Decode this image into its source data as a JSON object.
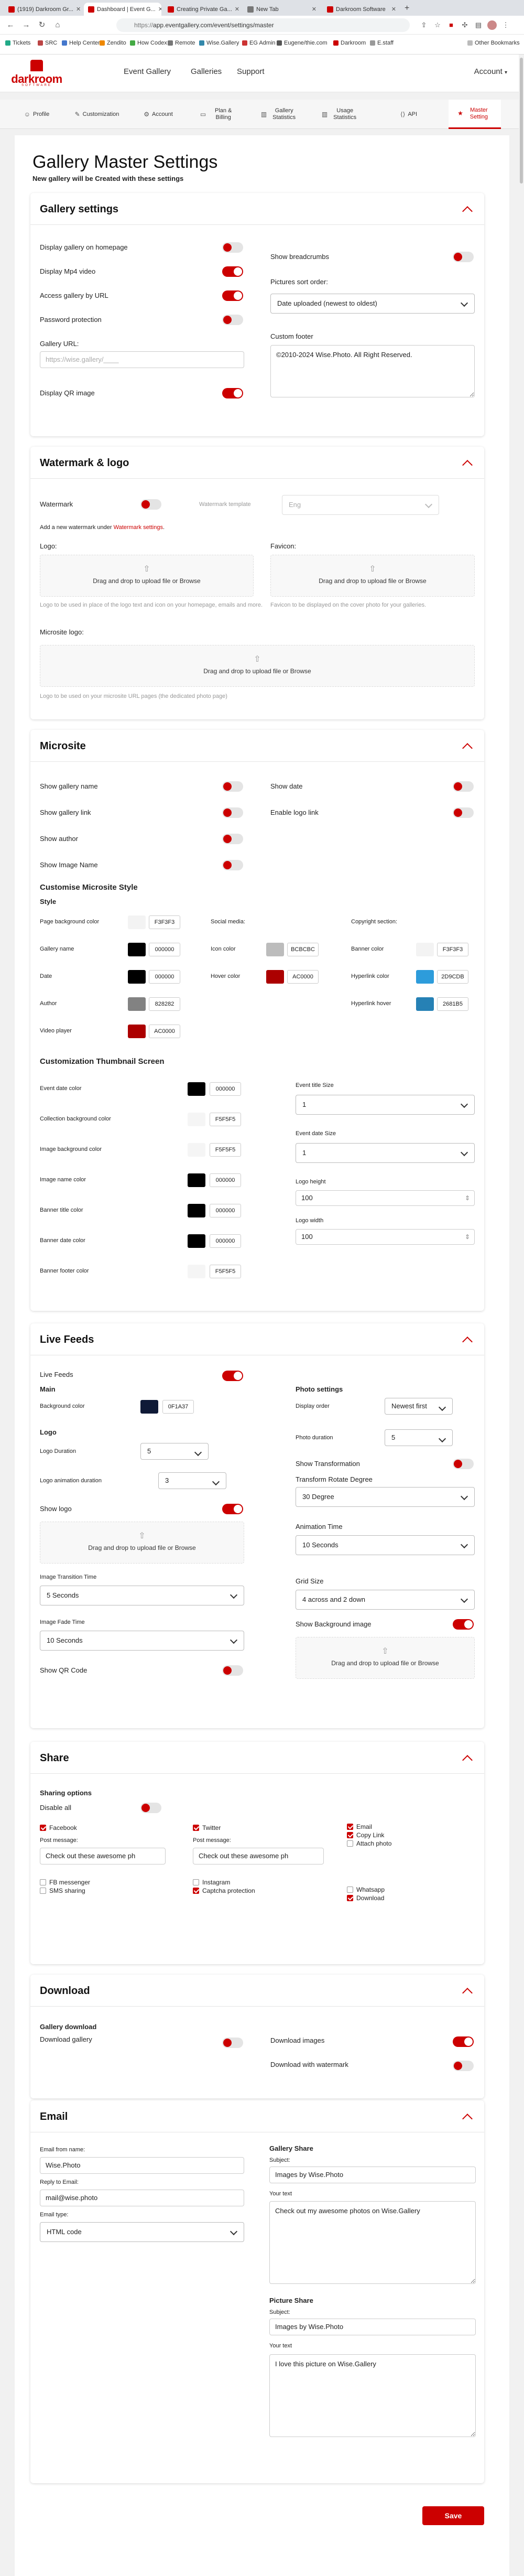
{
  "browser": {
    "tabs": [
      {
        "label": "(1919) Darkroom Gr..."
      },
      {
        "label": "Dashboard | Event G..."
      },
      {
        "label": "Creating Private Ga..."
      },
      {
        "label": "New Tab"
      },
      {
        "label": "Darkroom Software"
      }
    ],
    "url_scheme": "https://",
    "url_rest": "app.eventgallery.com/event/settings/master",
    "bookmarks": [
      "Tickets",
      "SRC",
      "Help Center",
      "Zendito",
      "How Codex",
      "Remote",
      "Wise.Gallery",
      "EG Admin",
      "Eugene/thie.com",
      "Darkroom",
      "E.staff"
    ],
    "other_bookmarks": "Other Bookmarks"
  },
  "app": {
    "logo_text": "darkroom",
    "logo_sub": "SOFTWARE",
    "nav": [
      "Event Gallery",
      "Galleries",
      "Support"
    ],
    "account": "Account"
  },
  "settings_tabs": [
    {
      "label": "Profile",
      "icon": "user-icon"
    },
    {
      "label": "Customization",
      "icon": "brush-icon"
    },
    {
      "label": "Account",
      "icon": "gear-icon"
    },
    {
      "label": "Plan & Billing",
      "icon": "card-icon"
    },
    {
      "label": "Gallery Statistics",
      "icon": "chart-icon"
    },
    {
      "label": "Usage Statistics",
      "icon": "chart-icon"
    },
    {
      "label": "API",
      "icon": "code-icon"
    },
    {
      "label": "Master Setting",
      "icon": "star-icon"
    }
  ],
  "page": {
    "title": "Gallery Master Settings",
    "subtitle": "New gallery will be Created with these settings"
  },
  "gallery": {
    "heading": "Gallery settings",
    "display_homepage": "Display gallery on homepage",
    "display_mp4": "Display Mp4 video",
    "access_url": "Access gallery by URL",
    "password": "Password protection",
    "url_label": "Gallery URL:",
    "url_placeholder": "https://wise.gallery/____",
    "display_qr": "Display QR image",
    "breadcrumbs": "Show breadcrumbs",
    "sort_label": "Pictures sort order:",
    "sort_value": "Date uploaded (newest to oldest)",
    "footer_label": "Custom footer",
    "footer_value": "©2010-2024 Wise.Photo. All Right Reserved."
  },
  "watermark": {
    "heading": "Watermark & logo",
    "watermark_label": "Watermark",
    "template_label": "Watermark template",
    "template_value": "Eng",
    "add_note_prefix": "Add a new watermark under ",
    "add_note_link": "Watermark settings",
    "add_note_suffix": ".",
    "logo_label": "Logo:",
    "favicon_label": "Favicon:",
    "drop_text": "Drag and drop to upload file or Browse",
    "logo_help": "Logo to be used in place of the logo text and icon on your homepage, emails and more.",
    "favicon_help": "Favicon to be displayed on the cover photo for your galleries.",
    "microsite_logo_label": "Microsite logo:",
    "microsite_logo_help": "Logo to be used on your microsite URL pages (the dedicated photo page)"
  },
  "microsite": {
    "heading": "Microsite",
    "show_gallery_name": "Show gallery name",
    "show_gallery_link": "Show gallery link",
    "show_author": "Show author",
    "show_image_name": "Show Image Name",
    "show_date": "Show date",
    "enable_logo_link": "Enable logo link",
    "customise_heading": "Customise Microsite Style",
    "style_heading": "Style",
    "page_bg_label": "Page background color",
    "page_bg_hex": "F3F3F3",
    "gallery_name_label": "Gallery name",
    "gallery_name_hex": "000000",
    "date_label": "Date",
    "date_hex": "000000",
    "author_label": "Author",
    "author_hex": "828282",
    "video_label": "Video player",
    "video_hex": "AC0000",
    "social_heading": "Social media:",
    "icon_color_label": "Icon color",
    "icon_color_hex": "BCBCBC",
    "hover_color_label": "Hover color",
    "hover_color_hex": "AC0000",
    "copyright_heading": "Copyright section:",
    "banner_color_label": "Banner color",
    "banner_color_hex": "F3F3F3",
    "hyperlink_label": "Hyperlink color",
    "hyperlink_hex": "2D9CDB",
    "hyperlink_hover_label": "Hyperlink hover",
    "hyperlink_hover_hex": "2681B5",
    "thumb_heading": "Customization Thumbnail Screen",
    "thumb_rows": [
      {
        "label": "Event date color",
        "hex": "000000",
        "swatch": "#000000"
      },
      {
        "label": "Collection background color",
        "hex": "F5F5F5",
        "swatch": "#F5F5F5"
      },
      {
        "label": "Image background color",
        "hex": "F5F5F5",
        "swatch": "#F5F5F5"
      },
      {
        "label": "Image name color",
        "hex": "000000",
        "swatch": "#000000"
      },
      {
        "label": "Banner title color",
        "hex": "000000",
        "swatch": "#000000"
      },
      {
        "label": "Banner date color",
        "hex": "000000",
        "swatch": "#000000"
      },
      {
        "label": "Banner footer color",
        "hex": "F5F5F5",
        "swatch": "#F5F5F5"
      }
    ],
    "event_title_size_label": "Event title Size",
    "event_title_size_value": "1",
    "event_date_size_label": "Event date Size",
    "event_date_size_value": "1",
    "logo_height_label": "Logo height",
    "logo_height_value": "100",
    "logo_width_label": "Logo width",
    "logo_width_value": "100"
  },
  "live": {
    "heading": "Live Feeds",
    "live_feeds_label": "Live Feeds",
    "main_heading": "Main",
    "bg_color_label": "Background color",
    "bg_color_hex": "0F1A37",
    "logo_heading": "Logo",
    "logo_duration_label": "Logo Duration",
    "logo_duration_value": "5",
    "logo_anim_label": "Logo animation duration",
    "logo_anim_value": "3",
    "show_logo_label": "Show logo",
    "drop_text": "Drag and drop to upload file or Browse",
    "transition_label": "Image Transition Time",
    "transition_value": "5 Seconds",
    "fade_label": "Image Fade Time",
    "fade_value": "10 Seconds",
    "show_qr_label": "Show QR Code",
    "photo_heading": "Photo settings",
    "display_order_label": "Display order",
    "display_order_value": "Newest first",
    "photo_duration_label": "Photo duration",
    "photo_duration_value": "5",
    "show_transform_label": "Show Transformation",
    "rotate_label": "Transform Rotate Degree",
    "rotate_value": "30 Degree",
    "anim_time_label": "Animation Time",
    "anim_time_value": "10 Seconds",
    "grid_label": "Grid Size",
    "grid_value": "4 across and 2 down",
    "show_bg_label": "Show Background image"
  },
  "share": {
    "heading": "Share",
    "options_heading": "Sharing options",
    "disable_all": "Disable all",
    "facebook": "Facebook",
    "twitter": "Twitter",
    "email": "Email",
    "copy_link": "Copy Link",
    "attach_photo": "Attach photo",
    "post_message_label": "Post message:",
    "post_message_value": "Check out these awesome ph",
    "post_message_value2": "Check out these awesome ph",
    "fb_messenger": "FB messenger",
    "sms": "SMS sharing",
    "instagram": "Instagram",
    "captcha": "Captcha protection",
    "whatsapp": "Whatsapp",
    "download": "Download"
  },
  "download": {
    "heading": "Download",
    "gallery_download_heading": "Gallery download",
    "download_gallery": "Download gallery",
    "download_images": "Download images",
    "download_watermark": "Download with watermark"
  },
  "email": {
    "heading": "Email",
    "from_label": "Email from name:",
    "from_value": "Wise.Photo",
    "reply_label": "Reply to Email:",
    "reply_value": "mail@wise.photo",
    "type_label": "Email type:",
    "type_value": "HTML code",
    "gallery_share_heading": "Gallery Share",
    "subject_label": "Subject:",
    "gallery_subject": "Images by Wise.Photo",
    "your_text_label": "Your text",
    "gallery_text": "Check out my awesome photos on Wise.Gallery",
    "picture_share_heading": "Picture Share",
    "picture_subject_label": "Subject:",
    "picture_subject": "Images by Wise.Photo",
    "picture_text_label": "Your text",
    "picture_text": "I love this picture on Wise.Gallery"
  },
  "save_label": "Save",
  "colors": {
    "accent": "#cc0000",
    "page_bg": "#f1f1f1"
  }
}
